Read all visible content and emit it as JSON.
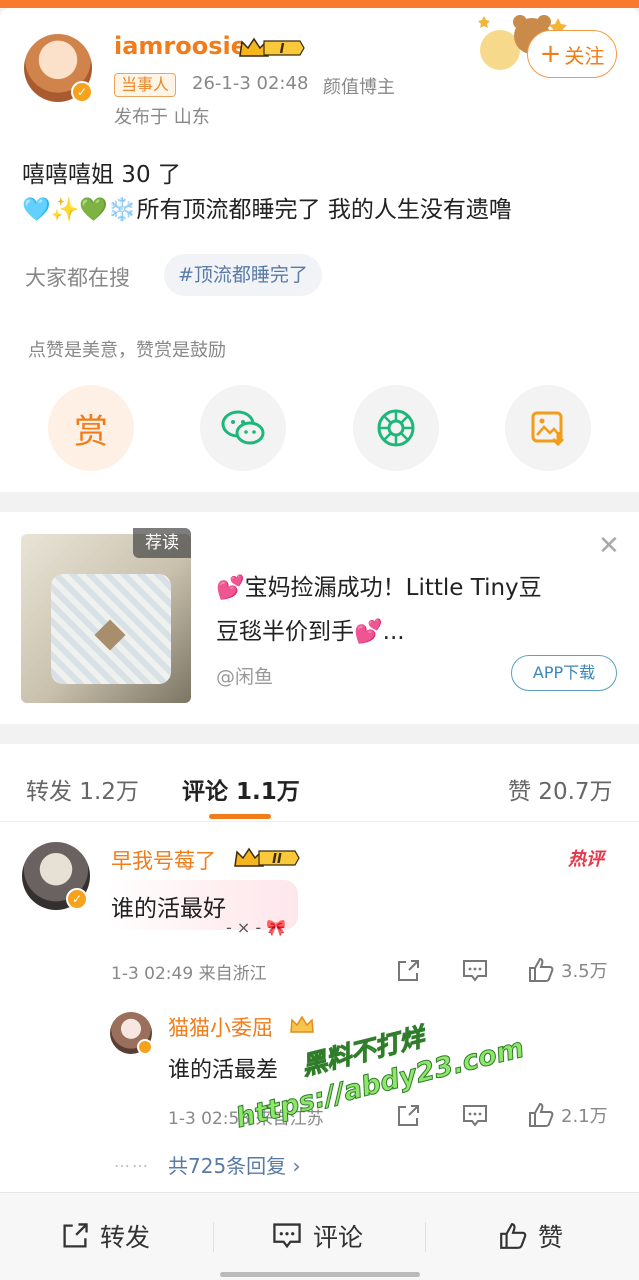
{
  "colors": {
    "accent": "#f07c1a",
    "link": "#5a7aa6",
    "hot": "#e6384b"
  },
  "post": {
    "author": "iamroosie",
    "vip_level": "I",
    "role_tag": "当事人",
    "time": "26-1-3 02:48",
    "author_desc": "颜值博主",
    "location": "发布于 山东",
    "follow_label": "关注",
    "content_line1": "嘻嘻嘻姐 30 了",
    "content_line2": "🩵✨💚❄️所有顶流都睡完了 我的人生没有遗噜",
    "search_hint": "大家都在搜",
    "hashtag": "#顶流都睡完了",
    "reward_hint": "点赞是美意，赞赏是鼓励",
    "reward_label": "赏",
    "share_icons": [
      "reward-icon",
      "wechat-icon",
      "moments-icon",
      "save-image-icon"
    ]
  },
  "ad": {
    "label": "荐读",
    "line1": "💕宝妈捡漏成功！Little Tiny豆",
    "line2": "豆毯半价到手💕...",
    "source": "@闲鱼",
    "button": "APP下载"
  },
  "tabs": {
    "repost": "转发 1.2万",
    "comment": "评论 1.1万",
    "like": "赞 20.7万"
  },
  "comment": {
    "user": "早我号莓了",
    "vip_level": "II",
    "hot_badge": "热评",
    "text": "谁的活最好",
    "deco": "- × -",
    "meta": "1-3 02:49  来自浙江",
    "likes": "3.5万",
    "reply": {
      "user": "猫猫小委屈",
      "text": "谁的活最差",
      "meta": "1-3 02:58  来自江苏",
      "likes": "2.1万"
    },
    "more_dots": "……",
    "more_replies": "共725条回复 ›"
  },
  "watermark": {
    "line1": "黑料不打烊",
    "line2": "https://abdy23.com"
  },
  "bottom_bar": {
    "repost": "转发",
    "comment": "评论",
    "like": "赞"
  }
}
